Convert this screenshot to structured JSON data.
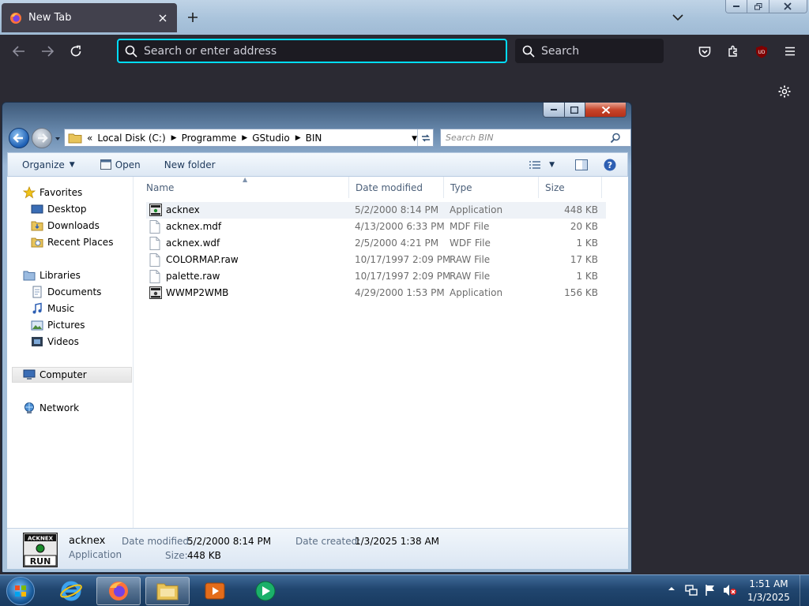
{
  "firefox": {
    "tab_title": "New Tab",
    "address_placeholder": "Search or enter address",
    "search_placeholder": "Search"
  },
  "explorer": {
    "breadcrumb": [
      "Local Disk (C:)",
      "Programme",
      "GStudio",
      "BIN"
    ],
    "search_placeholder": "Search BIN",
    "toolbar": {
      "organize": "Organize",
      "open": "Open",
      "new_folder": "New folder"
    },
    "nav": {
      "favorites": "Favorites",
      "favorites_items": [
        "Desktop",
        "Downloads",
        "Recent Places"
      ],
      "libraries": "Libraries",
      "libraries_items": [
        "Documents",
        "Music",
        "Pictures",
        "Videos"
      ],
      "computer": "Computer",
      "network": "Network"
    },
    "columns": {
      "name": "Name",
      "date": "Date modified",
      "type": "Type",
      "size": "Size"
    },
    "files": [
      {
        "name": "acknex",
        "date": "5/2/2000 8:14 PM",
        "type": "Application",
        "size": "448 KB",
        "icon": "app-icon"
      },
      {
        "name": "acknex.mdf",
        "date": "4/13/2000 6:33 PM",
        "type": "MDF File",
        "size": "20 KB",
        "icon": "file-icon"
      },
      {
        "name": "acknex.wdf",
        "date": "2/5/2000 4:21 PM",
        "type": "WDF File",
        "size": "1 KB",
        "icon": "file-icon"
      },
      {
        "name": "COLORMAP.raw",
        "date": "10/17/1997 2:09 PM",
        "type": "RAW File",
        "size": "17 KB",
        "icon": "file-icon"
      },
      {
        "name": "palette.raw",
        "date": "10/17/1997 2:09 PM",
        "type": "RAW File",
        "size": "1 KB",
        "icon": "file-icon"
      },
      {
        "name": "WWMP2WMB",
        "date": "4/29/2000 1:53 PM",
        "type": "Application",
        "size": "156 KB",
        "icon": "app-icon"
      }
    ],
    "details": {
      "name": "acknex",
      "kind": "Application",
      "modified_label": "Date modified:",
      "modified_value": "5/2/2000 8:14 PM",
      "created_label": "Date created:",
      "created_value": "1/3/2025 1:38 AM",
      "size_label": "Size:",
      "size_value": "448 KB",
      "icon_top": "ACKNEX",
      "icon_bottom": "RUN"
    }
  },
  "taskbar": {
    "time": "1:51 AM",
    "date": "1/3/2025"
  },
  "colors": {
    "firefox_bg": "#2b2a33",
    "urlbar_focus": "#00ddff",
    "explorer_selection": "#eef2f7",
    "taskbar": "#21466f"
  }
}
